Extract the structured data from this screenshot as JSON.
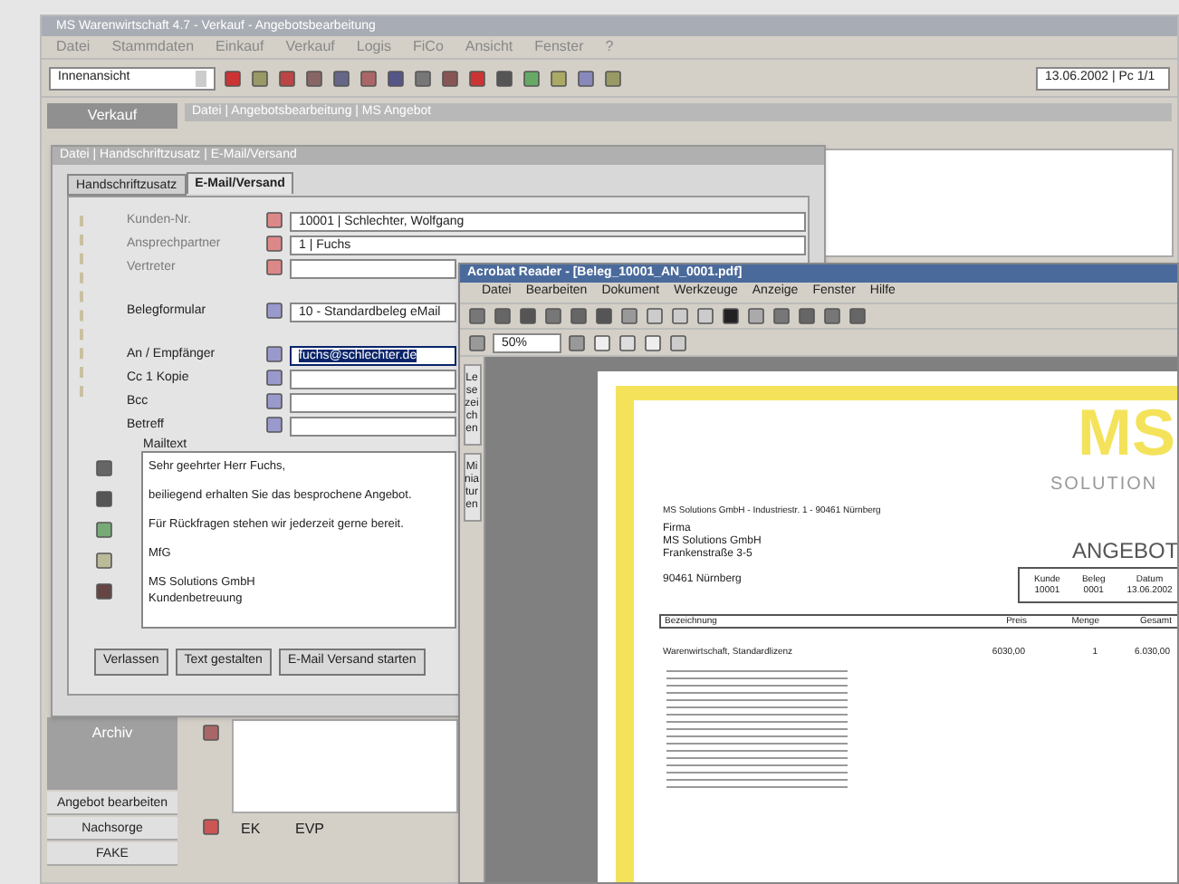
{
  "app": {
    "title": "MS Warenwirtschaft 4.7 - Verkauf - Angebotsbearbeitung",
    "menu": [
      "Datei",
      "Stammdaten",
      "Einkauf",
      "Verkauf",
      "Logis",
      "FiCo",
      "Ansicht",
      "Fenster",
      "?"
    ],
    "combo": "Innenansicht",
    "date": "13.06.2002 | Pc 1/1",
    "nav_tab": "Verkauf",
    "sub_title": "Datei | Angebotsbearbeitung | MS Angebot",
    "sidebar": [
      {
        "label": "Angebot bearbeiten",
        "selected": false
      },
      {
        "label": "Nachsorge",
        "selected": false
      },
      {
        "label": "FAKE",
        "selected": false
      }
    ],
    "sidebar_active": {
      "label": "Archiv",
      "selected": true
    },
    "grid_cells": [
      "EK",
      "EVP"
    ]
  },
  "dialog": {
    "title": "Datei | Handschriftzusatz | E-Mail/Versand",
    "tabs": [
      {
        "label": "Handschriftzusatz",
        "selected": false
      },
      {
        "label": "E-Mail/Versand",
        "selected": true
      }
    ],
    "fields": [
      {
        "label": "Kunden-Nr.",
        "value": "10001 | Schlechter, Wolfgang",
        "disabled": true,
        "highlighted": false
      },
      {
        "label": "Ansprechpartner",
        "value": "1 | Fuchs",
        "disabled": true,
        "highlighted": false
      },
      {
        "label": "Vertreter",
        "disabled": true,
        "highlighted": false
      },
      {
        "label": "Belegformular",
        "value": "10 - Standardbeleg eMail",
        "disabled": false,
        "highlighted": false
      },
      {
        "label": "An / Empfänger",
        "value": "fuchs@schlechter.de",
        "disabled": false,
        "highlighted": true
      },
      {
        "label": "Cc 1 Kopie",
        "disabled": false,
        "highlighted": false
      },
      {
        "label": "Bcc",
        "disabled": false,
        "highlighted": false
      },
      {
        "label": "Betreff",
        "disabled": false,
        "highlighted": false
      }
    ],
    "message_label": "Mailtext",
    "message": [
      "Sehr geehrter Herr Fuchs,",
      "beiliegend erhalten Sie das besprochene Angebot.",
      "Für Rückfragen stehen wir jederzeit gerne bereit.",
      "MfG",
      "MS Solutions GmbH\nKundenbetreuung"
    ],
    "buttons": [
      "Verlassen",
      "Text gestalten",
      "E-Mail Versand starten"
    ]
  },
  "reader": {
    "title": "Acrobat Reader - [Beleg_10001_AN_0001.pdf]",
    "menu": [
      "Datei",
      "Bearbeiten",
      "Dokument",
      "Werkzeuge",
      "Anzeige",
      "Fenster",
      "Hilfe"
    ],
    "zoom": "50%",
    "side_tabs": [
      "Lesezeichen",
      "Miniaturen"
    ],
    "doc": {
      "logo": "MS",
      "logo_sub": "SOLUTION",
      "sender": "MS Solutions GmbH - Industriestr. 1 - 90461 Nürnberg",
      "address": "Firma\nMS Solutions GmbH\nFrankenstraße 3-5\n\n90461 Nürnberg",
      "heading": "ANGEBOT",
      "info": [
        [
          "Kunde",
          "10001"
        ],
        [
          "Beleg",
          "0001"
        ],
        [
          "Datum",
          "13.06.2002"
        ]
      ],
      "columns": [
        "Bezeichnung",
        "Preis",
        "Menge",
        "Gesamt"
      ],
      "rows": [
        [
          "Warenwirtschaft, Standardlizenz",
          "6030,00",
          "1",
          "6.030,00"
        ]
      ]
    }
  }
}
